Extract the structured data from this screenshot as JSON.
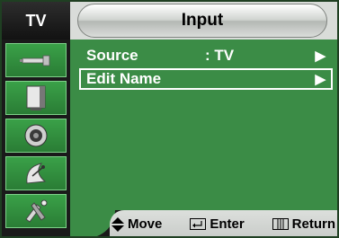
{
  "header": {
    "tab_label": "TV",
    "title": "Input"
  },
  "sidebar": {
    "items": [
      {
        "icon": "antenna-icon"
      },
      {
        "icon": "screen-icon"
      },
      {
        "icon": "speaker-icon"
      },
      {
        "icon": "satellite-dish-icon"
      },
      {
        "icon": "setup-tools-icon"
      }
    ]
  },
  "menu": {
    "rows": [
      {
        "label": "Source",
        "value": ": TV",
        "arrow": "▶"
      },
      {
        "label": "Edit Name",
        "value": "",
        "arrow": "▶"
      }
    ],
    "selected_index": 1
  },
  "footer": {
    "move_label": "Move",
    "enter_label": "Enter",
    "return_label": "Return"
  },
  "colors": {
    "panel": "#3b8c46",
    "sidebar_bg": "#1a1a1a",
    "header_bg": "#d9dcd9"
  }
}
